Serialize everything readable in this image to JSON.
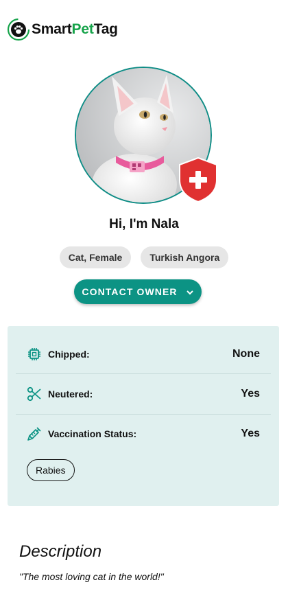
{
  "header": {
    "brand_part1": "Smart",
    "brand_part2": "Pet",
    "brand_part3": "Tag",
    "logo_icon": "paw-signal-icon",
    "accent_color": "#16a34a"
  },
  "profile": {
    "photo_icon": "white-cat-photo",
    "badge_icon": "medical-shield-icon",
    "greeting": "Hi, I'm Nala",
    "tags": [
      "Cat, Female",
      "Turkish Angora"
    ],
    "contact_label": "CONTACT OWNER",
    "primary_color": "#0c9384"
  },
  "info": {
    "rows": [
      {
        "icon": "chip-icon",
        "label": "Chipped:",
        "value": "None"
      },
      {
        "icon": "scissors-icon",
        "label": "Neutered:",
        "value": "Yes"
      },
      {
        "icon": "syringe-icon",
        "label": "Vaccination Status:",
        "value": "Yes"
      }
    ],
    "vaccines": [
      "Rabies"
    ],
    "card_color": "#e0f0ef"
  },
  "description": {
    "title": "Description",
    "text": "\"The most loving cat in the world!\""
  }
}
